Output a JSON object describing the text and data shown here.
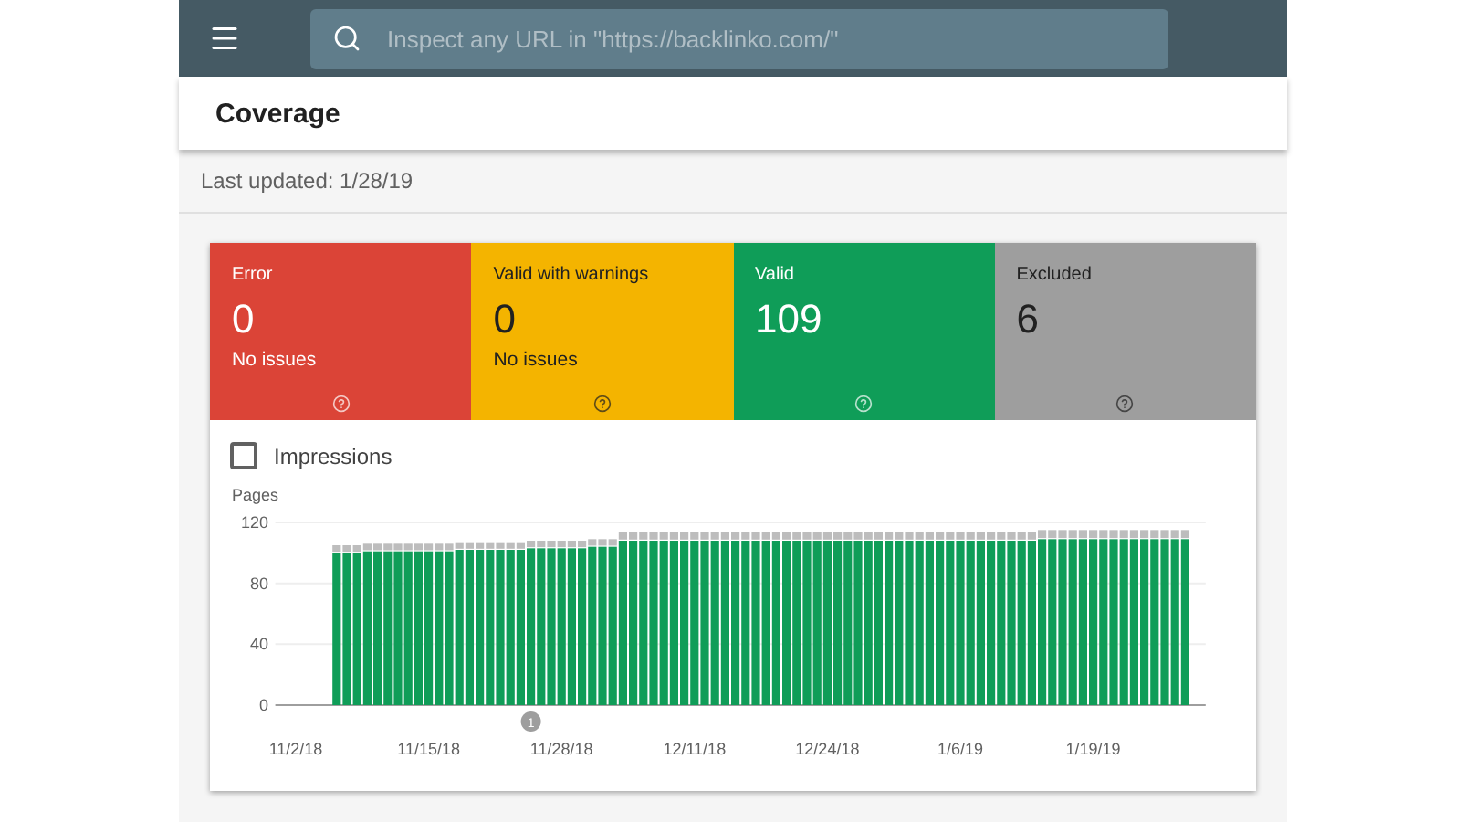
{
  "search": {
    "placeholder": "Inspect any URL in \"https://backlinko.com/\""
  },
  "header": {
    "title": "Coverage"
  },
  "last_updated": "Last updated: 1/28/19",
  "tiles": [
    {
      "label": "Error",
      "count": "0",
      "note": "No issues",
      "color": "#db4437",
      "selected": true
    },
    {
      "label": "Valid with warnings",
      "count": "0",
      "note": "No issues",
      "color": "#f4b400",
      "selected": true
    },
    {
      "label": "Valid",
      "count": "109",
      "color": "#0f9d58",
      "selected": true
    },
    {
      "label": "Excluded",
      "count": "6",
      "color": "#9e9e9e",
      "selected": true
    }
  ],
  "impressions": {
    "label": "Impressions",
    "checked": false
  },
  "chart": {
    "chart_data": {
      "type": "bar",
      "stacked": true,
      "ylabel": "Pages",
      "ylim": [
        0,
        120
      ],
      "yticks": [
        0,
        40,
        80,
        120
      ],
      "categories": [
        "11/2/18",
        null,
        null,
        null,
        null,
        null,
        null,
        null,
        null,
        null,
        null,
        null,
        null,
        "11/15/18",
        null,
        null,
        null,
        null,
        null,
        null,
        null,
        null,
        null,
        null,
        null,
        null,
        "11/28/18",
        null,
        null,
        null,
        null,
        null,
        null,
        null,
        null,
        null,
        null,
        null,
        null,
        "12/11/18",
        null,
        null,
        null,
        null,
        null,
        null,
        null,
        null,
        null,
        null,
        null,
        null,
        "12/24/18",
        null,
        null,
        null,
        null,
        null,
        null,
        null,
        null,
        null,
        null,
        null,
        null,
        "1/6/19",
        null,
        null,
        null,
        null,
        null,
        null,
        null,
        null,
        null,
        null,
        null,
        null,
        "1/19/19",
        null,
        null,
        null,
        null,
        null,
        null,
        null,
        null,
        null
      ],
      "series": [
        {
          "color": "#0f9d58",
          "values": [
            null,
            null,
            null,
            null,
            100,
            100,
            100,
            101,
            101,
            101,
            101,
            101,
            101,
            101,
            101,
            101,
            102,
            102,
            102,
            102,
            102,
            102,
            102,
            103,
            103,
            103,
            103,
            103,
            103,
            104,
            104,
            104,
            108,
            108,
            108,
            108,
            108,
            108,
            108,
            108,
            108,
            108,
            108,
            108,
            108,
            108,
            108,
            108,
            108,
            108,
            108,
            108,
            108,
            108,
            108,
            108,
            108,
            108,
            108,
            108,
            108,
            108,
            108,
            108,
            108,
            108,
            108,
            108,
            108,
            108,
            108,
            108,
            108,
            109,
            109,
            109,
            109,
            109,
            109,
            109,
            109,
            109,
            109,
            109,
            109,
            109,
            109,
            109
          ]
        },
        {
          "color": "#bdbdbd",
          "values": [
            null,
            null,
            null,
            null,
            5,
            5,
            5,
            5,
            5,
            5,
            5,
            5,
            5,
            5,
            5,
            5,
            5,
            5,
            5,
            5,
            5,
            5,
            5,
            5,
            5,
            5,
            5,
            5,
            5,
            5,
            5,
            5,
            6,
            6,
            6,
            6,
            6,
            6,
            6,
            6,
            6,
            6,
            6,
            6,
            6,
            6,
            6,
            6,
            6,
            6,
            6,
            6,
            6,
            6,
            6,
            6,
            6,
            6,
            6,
            6,
            6,
            6,
            6,
            6,
            6,
            6,
            6,
            6,
            6,
            6,
            6,
            6,
            6,
            6,
            6,
            6,
            6,
            6,
            6,
            6,
            6,
            6,
            6,
            6,
            6,
            6,
            6,
            6
          ]
        }
      ],
      "annotations": [
        "1"
      ]
    }
  }
}
